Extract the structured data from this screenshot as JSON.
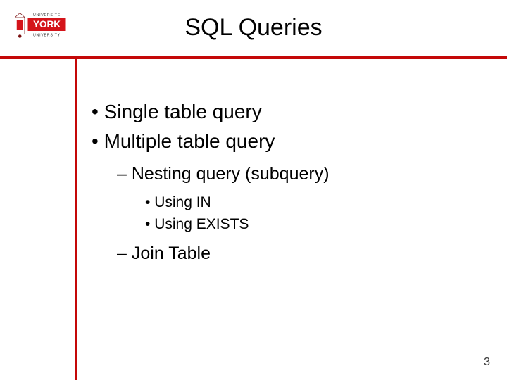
{
  "title": "SQL Queries",
  "logo": {
    "top_text": "UNIVERSITÉ",
    "main_text": "YORK",
    "bottom_text": "UNIVERSITY"
  },
  "bullets": {
    "l1_0": "Single table query",
    "l1_1": "Multiple table query",
    "l2_0": "Nesting query (subquery)",
    "l3_0": "Using IN",
    "l3_1": "Using EXISTS",
    "l2_1": "Join Table"
  },
  "page_number": "3"
}
